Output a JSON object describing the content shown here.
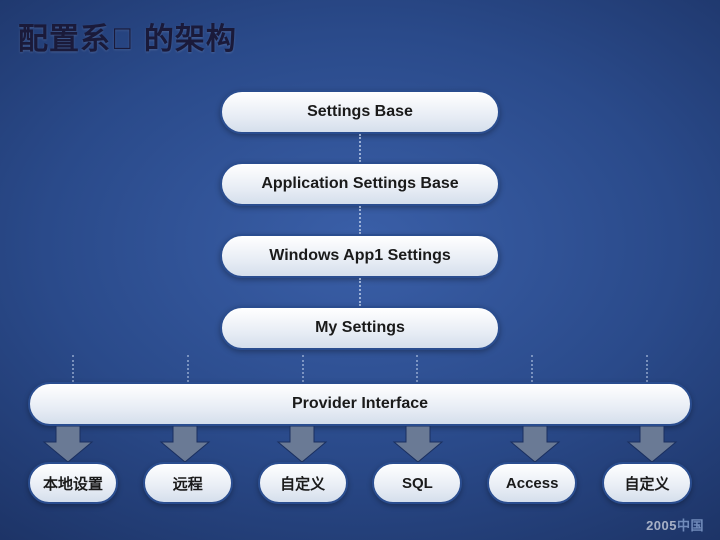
{
  "title": "配置系\u0000 的架构",
  "stack": [
    "Settings Base",
    "Application Settings Base",
    "Windows App1 Settings",
    "My Settings"
  ],
  "provider": "Provider Interface",
  "leaves": [
    "本地设置",
    "远程",
    "自定义",
    "SQL",
    "Access",
    "自定义"
  ],
  "footer_year": "2005",
  "footer_suffix": "中国"
}
